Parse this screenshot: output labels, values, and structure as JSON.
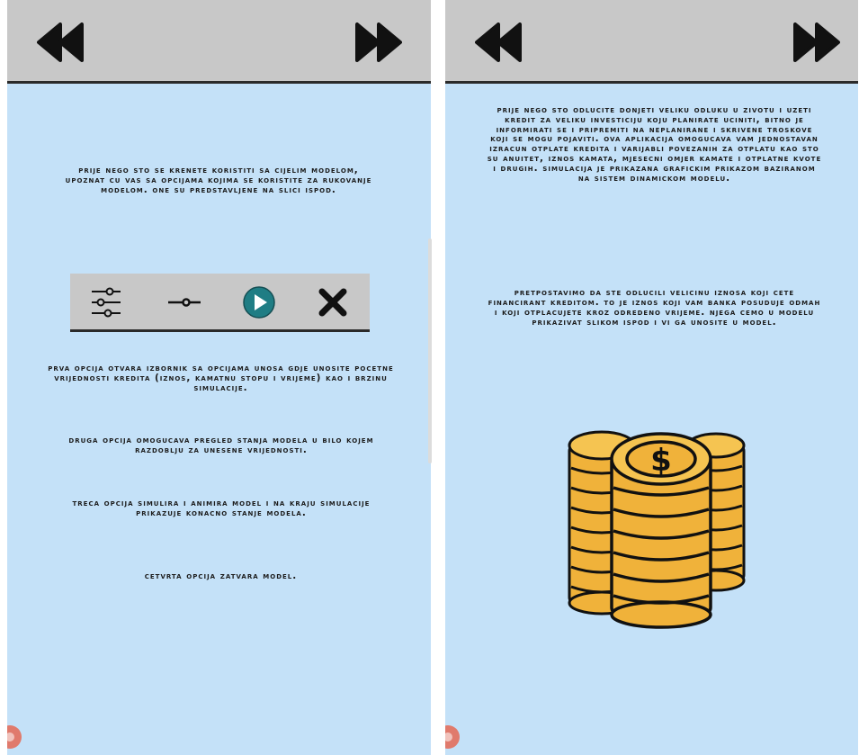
{
  "left_screen": {
    "intro_text": "Prije nego sto se krenete koristiti sa cijelim modelom, upoznat cu vas sa opcijama kojima se koristite za rukovanje modelom. One su predstavljene na slici ispod.",
    "toolbar_icons": [
      "sliders-icon",
      "single-slider-icon",
      "play-icon",
      "close-icon"
    ],
    "option1_text": "Prva opcija otvara izbornik sa opcijama unosa gdje unosite pocetne vrijednosti kredita (iznos, kamatnu stopu i vrijeme) kao i brzinu simulacije.",
    "option2_text": "Druga opcija omogucava pregled stanja modela u bilo kojem razdoblju za unesene vrijednosti.",
    "option3_text": "Treca opcija simulira i animira model i na kraju simulacije prikazuje konacno stanje modela.",
    "option4_text": "Cetvrta opcija zatvara model."
  },
  "right_screen": {
    "paragraph1": "Prije nego sto odlucite donjeti veliku odluku u zivotu i uzeti kredit za veliku investiciju koju planirate uciniti, bitno je informirati se i pripremiti na neplanirane i skrivene troskove koji se mogu pojaviti. Ova aplikacija omogucava vam jednostavan izracun otplate kredita i varijabli povezanih za otplatu kao sto su anuitet, iznos kamata, mjesecni omjer kamate i otplatne kvote i drugih. Simulacija je prikazana grafickim prikazom baziranom na sistem dinamickom modelu.",
    "paragraph2": "Pretpostavimo da ste odlucili velicinu iznosa koji cete financirant kreditom. To je iznos koji vam banka posuduje odmah i koji otplacujete kroz odredeno vrijeme. Njega cemo u modelu prikazivat slikom ispod i vi ga unosite u model.",
    "coin_symbol": "$"
  },
  "icons": {
    "back": "rewind-icon",
    "forward": "fast-forward-icon"
  },
  "colors": {
    "background": "#c4e1f8",
    "topbar": "#c8c8c8",
    "play": "#1f7d84",
    "coin": "#f0b23a",
    "fab": "#e07a6c"
  }
}
